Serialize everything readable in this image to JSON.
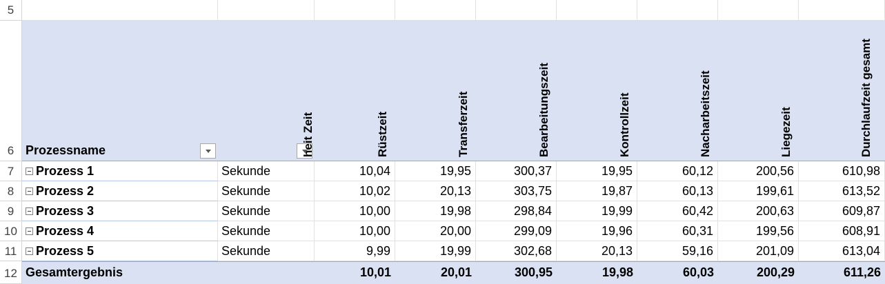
{
  "row_numbers": [
    "5",
    "6",
    "7",
    "8",
    "9",
    "10",
    "11",
    "12"
  ],
  "header": {
    "prozessname": "Prozessname",
    "einheit_zeit_clipped": "heit Zeit",
    "columns": [
      "Rüstzeit",
      "Transferzeit",
      "Bearbeitungszeit",
      "Kontrollzeit",
      "Nacharbeitszeit",
      "Liegezeit",
      "Durchlaufzeit gesamt"
    ]
  },
  "rows": [
    {
      "name": "Prozess 1",
      "unit": "Sekunde",
      "values": [
        "10,04",
        "19,95",
        "300,37",
        "19,95",
        "60,12",
        "200,56",
        "610,98"
      ]
    },
    {
      "name": "Prozess 2",
      "unit": "Sekunde",
      "values": [
        "10,02",
        "20,13",
        "303,75",
        "19,87",
        "60,13",
        "199,61",
        "613,52"
      ]
    },
    {
      "name": "Prozess 3",
      "unit": "Sekunde",
      "values": [
        "10,00",
        "19,98",
        "298,84",
        "19,99",
        "60,42",
        "200,63",
        "609,87"
      ]
    },
    {
      "name": "Prozess 4",
      "unit": "Sekunde",
      "values": [
        "10,00",
        "20,00",
        "299,09",
        "19,96",
        "60,31",
        "199,56",
        "608,91"
      ]
    },
    {
      "name": "Prozess 5",
      "unit": "Sekunde",
      "values": [
        "9,99",
        "19,99",
        "302,68",
        "20,13",
        "59,16",
        "201,09",
        "613,04"
      ]
    }
  ],
  "total": {
    "label": "Gesamtergebnis",
    "values": [
      "10,01",
      "20,01",
      "300,95",
      "19,98",
      "60,03",
      "200,29",
      "611,26"
    ]
  },
  "colors": {
    "header_band": "#d9e1f2",
    "gridline": "#e1e1e1"
  }
}
